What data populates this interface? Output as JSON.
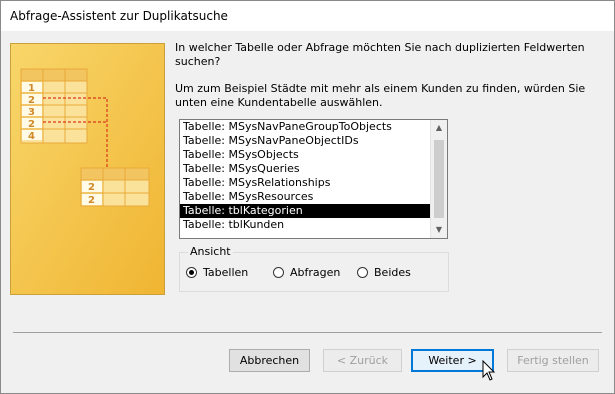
{
  "window": {
    "title": "Abfrage-Assistent zur Duplikatsuche"
  },
  "illustration": {
    "top_rows": [
      "1",
      "2",
      "3",
      "2",
      "4"
    ],
    "bottom_rows": [
      "2",
      "2"
    ]
  },
  "prompt": {
    "question": "In welcher Tabelle oder Abfrage möchten Sie nach duplizierten Feldwerten suchen?",
    "example": "Um zum Beispiel Städte mit mehr als einem Kunden zu finden, würden Sie unten eine Kundentabelle auswählen."
  },
  "list": {
    "items": [
      "Tabelle: MSysNavPaneGroupToObjects",
      "Tabelle: MSysNavPaneObjectIDs",
      "Tabelle: MSysObjects",
      "Tabelle: MSysQueries",
      "Tabelle: MSysRelationships",
      "Tabelle: MSysResources",
      "Tabelle: tblKategorien",
      "Tabelle: tblKunden"
    ],
    "selected": "Tabelle: tblKategorien"
  },
  "view_group": {
    "legend": "Ansicht",
    "options": [
      "Tabellen",
      "Abfragen",
      "Beides"
    ],
    "selected": "Tabellen"
  },
  "buttons": {
    "cancel": "Abbrechen",
    "back": "< Zurück",
    "next": "Weiter >",
    "finish": "Fertig stellen"
  }
}
